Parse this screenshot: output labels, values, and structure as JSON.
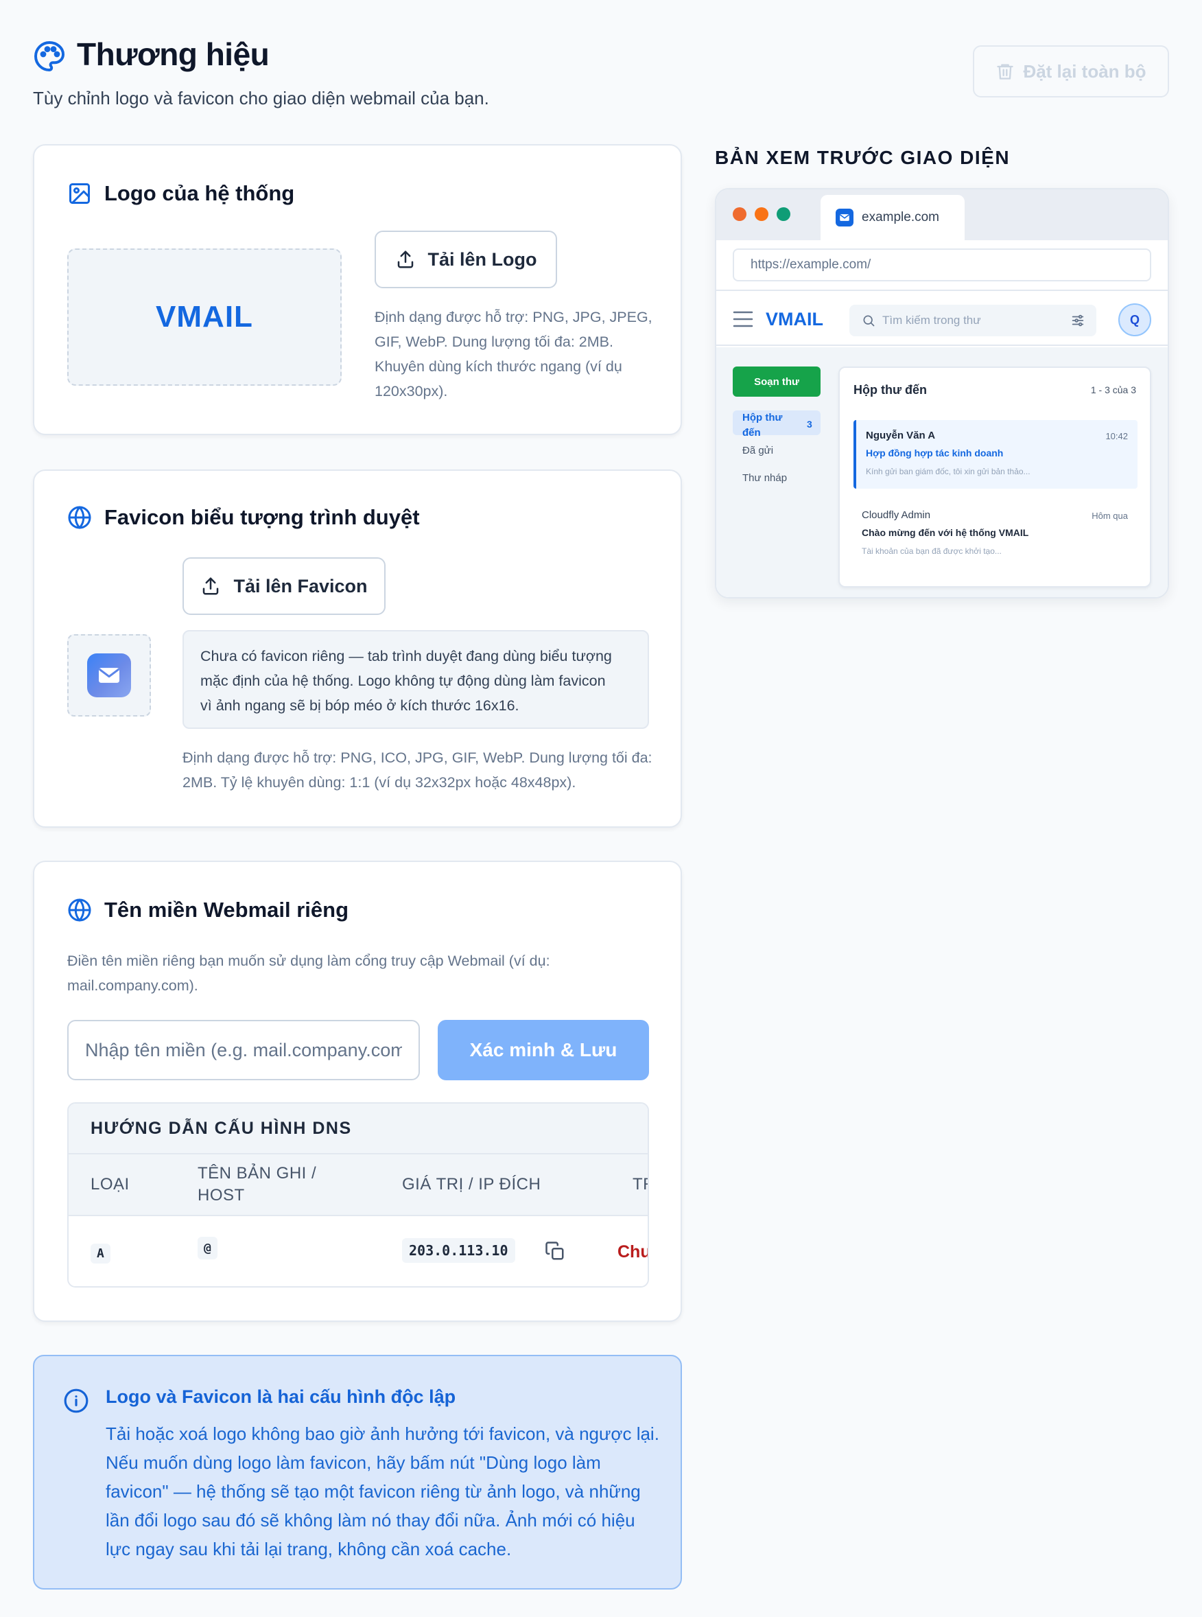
{
  "header": {
    "title": "Thương hiệu",
    "subtitle": "Tùy chỉnh logo và favicon cho giao diện webmail của bạn.",
    "reset_label": "Đặt lại toàn bộ"
  },
  "logo_card": {
    "title": "Logo của hệ thống",
    "preview_text": "VMAIL",
    "upload_label": "Tải lên Logo",
    "hint_lines": [
      "Định dạng được hỗ trợ: PNG, JPG, JPEG,",
      "GIF, WebP. Dung lượng tối đa: 2MB.",
      "Khuyên dùng kích thước ngang (ví dụ",
      "120x30px)."
    ]
  },
  "favicon_card": {
    "title": "Favicon biểu tượng trình duyệt",
    "upload_label": "Tải lên Favicon",
    "notice_lines": [
      "Chưa có favicon riêng — tab trình duyệt đang dùng biểu tượng",
      "mặc định của hệ thống. Logo không tự động dùng làm favicon",
      "vì ảnh ngang sẽ bị bóp méo ở kích thước 16x16."
    ],
    "hint_lines": [
      "Định dạng được hỗ trợ: PNG, ICO, JPG, GIF, WebP. Dung lượng tối đa:",
      "2MB. Tỷ lệ khuyên dùng: 1:1 (ví dụ 32x32px hoặc 48x48px)."
    ]
  },
  "domain_card": {
    "title": "Tên miền Webmail riêng",
    "desc_lines": [
      "Điền tên miền riêng bạn muốn sử dụng làm cổng truy cập Webmail (ví dụ:",
      "mail.company.com)."
    ],
    "input_placeholder": "Nhập tên miền (e.g. mail.company.com)",
    "verify_label": "Xác minh & Lưu",
    "dns": {
      "title": "HƯỚNG DẪN CẤU HÌNH DNS",
      "columns": [
        "LOẠI",
        "TÊN BẢN GHI /",
        "HOST",
        "GIÁ TRỊ / IP ĐÍCH",
        "TR"
      ],
      "row": {
        "type": "A",
        "host": "@",
        "value": "203.0.113.10",
        "status": "Chu"
      }
    }
  },
  "info_box": {
    "title": "Logo và Favicon là hai cấu hình độc lập",
    "lines": [
      "Tải hoặc xoá logo không bao giờ ảnh hưởng tới favicon, và ngược lại.",
      "Nếu muốn dùng logo làm favicon, hãy bấm nút \"Dùng logo làm",
      "favicon\" — hệ thống sẽ tạo một favicon riêng từ ảnh logo, và những",
      "lần đổi logo sau đó sẽ không làm nó thay đổi nữa. Ảnh mới có hiệu",
      "lực ngay sau khi tải lại trang, không cần xoá cache."
    ]
  },
  "preview": {
    "title": "BẢN XEM TRƯỚC GIAO DIỆN",
    "tab_label": "example.com",
    "url": "https://example.com/",
    "brand": "VMAIL",
    "search_placeholder": "Tìm kiếm trong thư",
    "avatar": "Q",
    "compose": "Soạn thư",
    "folders": {
      "inbox_line1": "Hộp thư",
      "inbox_line2": "đến",
      "inbox_count": "3",
      "sent": "Đã gửi",
      "drafts": "Thư nháp"
    },
    "inbox_title": "Hộp thư đến",
    "inbox_range": "1 - 3 của 3",
    "mails": [
      {
        "sender": "Nguyễn Văn A",
        "time": "10:42",
        "subject": "Hợp đồng hợp tác kinh doanh",
        "snippet": "Kính gửi ban giám đốc, tôi xin gửi bản thảo..."
      },
      {
        "sender": "Cloudfly Admin",
        "time": "Hôm qua",
        "subject": "Chào mừng đến với hệ thống VMAIL",
        "snippet": "Tài khoản của bạn đã được khởi tạo..."
      }
    ]
  },
  "colors": {
    "primary": "#1468e0",
    "success": "#16a34a",
    "danger": "#b91c1c",
    "dot_red": "#ef6b2e",
    "dot_orange": "#f97316",
    "dot_green": "#0f9d76"
  }
}
